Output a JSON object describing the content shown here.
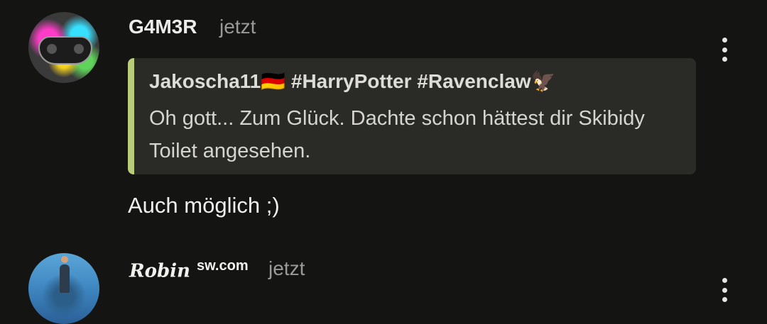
{
  "comments": [
    {
      "username": "G4M3R",
      "time": "jetzt",
      "quote": {
        "author": "Jakoscha11🇩🇪 #HarryPotter #Ravenclaw🦅",
        "text": "Oh gott... Zum Glück. Dachte schon hättest dir Skibidy Toilet angesehen."
      },
      "body": "Auch möglich ;)"
    },
    {
      "username_script": "Robin",
      "username_sup": "sw.com",
      "time": "jetzt"
    }
  ],
  "colors": {
    "background": "#141412",
    "quote_bar": "#b9cc79",
    "quote_bg": "#2a2a27"
  },
  "icons": {
    "more_menu": "vertical-ellipsis-icon"
  }
}
